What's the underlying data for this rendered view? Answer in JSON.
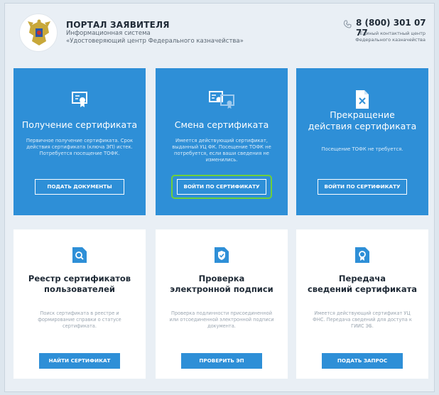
{
  "header": {
    "title": "ПОРТАЛ ЗАЯВИТЕЛЯ",
    "subtitle_line1": "Информационная система",
    "subtitle_line2": "«Удостоверяющий центр Федерального казначейства»",
    "phone": "8 (800) 301 07 77",
    "phone_note_line1": "Единый контактный центр",
    "phone_note_line2": "Федерального казначейства"
  },
  "cards_top": [
    {
      "title": "Получение сертификата",
      "description": "Первичное получение сертификата. Срок действия сертификата (ключа ЭП) истек. Потребуется посещение ТОФК.",
      "button": "ПОДАТЬ ДОКУМЕНТЫ",
      "icon": "certificate-icon"
    },
    {
      "title": "Смена сертификата",
      "description": "Имеется действующий сертификат, выданный УЦ ФК. Посещение ТОФК не потребуется, если ваши сведения не изменились.",
      "button": "ВОЙТИ ПО СЕРТИФИКАТУ",
      "icon": "certificate-swap-icon"
    },
    {
      "title_line1": "Прекращение",
      "title_line2": "действия сертификата",
      "description": "Посещение ТОФК не требуется.",
      "button": "ВОЙТИ ПО СЕРТИФИКАТУ",
      "icon": "document-cancel-icon"
    }
  ],
  "cards_bottom": [
    {
      "title_line1": "Реестр сертификатов",
      "title_line2": "пользователей",
      "description": "Поиск сертификата в реестре и формирование справки о статусе сертификата.",
      "button": "НАЙТИ СЕРТИФИКАТ",
      "icon": "search-icon"
    },
    {
      "title_line1": "Проверка",
      "title_line2": "электронной подписи",
      "description": "Проверка подлинности присоединенной или отсоединенной электронной подписи документа.",
      "button": "ПРОВЕРИТЬ ЭП",
      "icon": "shield-check-icon"
    },
    {
      "title_line1": "Передача",
      "title_line2": "сведений сертификата",
      "description": "Имеется действующий сертификат УЦ ФНС. Передача сведений для доступа к ГИИС ЭБ.",
      "button": "ПОДАТЬ ЗАПРОС",
      "icon": "award-icon"
    }
  ],
  "colors": {
    "accent_blue": "#2e8fd7",
    "highlight_green": "#6fcf3a",
    "background": "#e9eff5"
  }
}
